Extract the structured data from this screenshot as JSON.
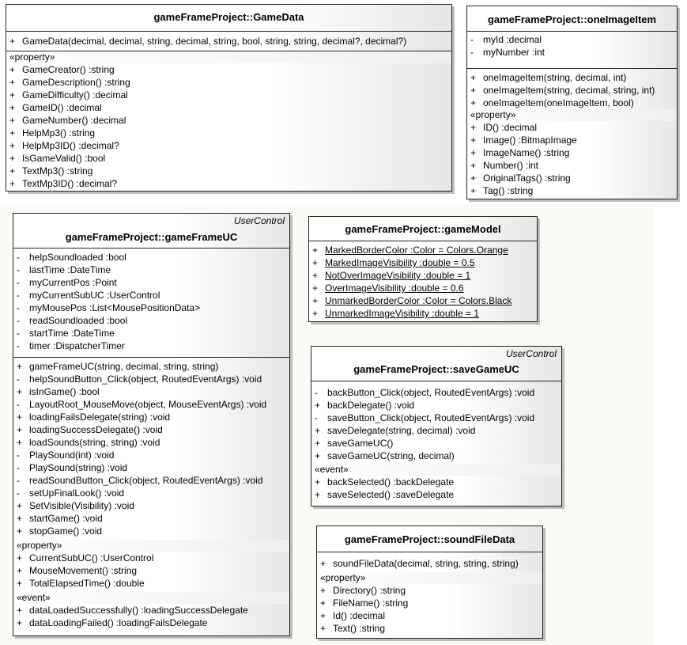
{
  "classes": {
    "gamedata": {
      "title": "gameFrameProject::GameData",
      "ctor": [
        {
          "v": "+",
          "t": "GameData(decimal, decimal, string, decimal, string, bool, string, string, decimal?, decimal?)"
        }
      ],
      "prop_label": "«property»",
      "props": [
        {
          "v": "+",
          "t": "GameCreator()  :string"
        },
        {
          "v": "+",
          "t": "GameDescription()  :string"
        },
        {
          "v": "+",
          "t": "GameDifficulty()  :decimal"
        },
        {
          "v": "+",
          "t": "GameID()  :decimal"
        },
        {
          "v": "+",
          "t": "GameNumber()  :decimal"
        },
        {
          "v": "+",
          "t": "HelpMp3()  :string"
        },
        {
          "v": "+",
          "t": "HelpMp3ID()  :decimal?"
        },
        {
          "v": "+",
          "t": "IsGameValid()  :bool"
        },
        {
          "v": "+",
          "t": "TextMp3()  :string"
        },
        {
          "v": "+",
          "t": "TextMp3ID()  :decimal?"
        }
      ]
    },
    "oneimageitem": {
      "title": "gameFrameProject::oneImageItem",
      "attrs": [
        {
          "v": "-",
          "t": "myId  :decimal"
        },
        {
          "v": "-",
          "t": "myNumber  :int"
        }
      ],
      "ops": [
        {
          "v": "+",
          "t": "oneImageItem(string, decimal, int)"
        },
        {
          "v": "+",
          "t": "oneImageItem(string, decimal, string, int)"
        },
        {
          "v": "+",
          "t": "oneImageItem(oneImageItem, bool)"
        }
      ],
      "prop_label": "«property»",
      "props": [
        {
          "v": "+",
          "t": "ID()  :decimal"
        },
        {
          "v": "+",
          "t": "Image()  :BitmapImage"
        },
        {
          "v": "+",
          "t": "ImageName()  :string"
        },
        {
          "v": "+",
          "t": "Number()  :int"
        },
        {
          "v": "+",
          "t": "OriginalTags()  :string"
        },
        {
          "v": "+",
          "t": "Tag()  :string"
        }
      ]
    },
    "gameframeuc": {
      "stereotype": "UserControl",
      "title": "gameFrameProject::gameFrameUC",
      "attrs": [
        {
          "v": "-",
          "t": "helpSoundloaded  :bool"
        },
        {
          "v": "-",
          "t": "lastTime  :DateTime"
        },
        {
          "v": "-",
          "t": "myCurrentPos  :Point"
        },
        {
          "v": "-",
          "t": "myCurrentSubUC  :UserControl"
        },
        {
          "v": "-",
          "t": "myMousePos  :List<MousePositionData>"
        },
        {
          "v": "-",
          "t": "readSoundloaded  :bool"
        },
        {
          "v": "-",
          "t": "startTime  :DateTime"
        },
        {
          "v": "-",
          "t": "timer  :DispatcherTimer"
        }
      ],
      "ops": [
        {
          "v": "+",
          "t": "gameFrameUC(string, decimal, string, string)"
        },
        {
          "v": "-",
          "t": "helpSoundButton_Click(object, RoutedEventArgs)  :void"
        },
        {
          "v": "+",
          "t": "isInGame()  :bool"
        },
        {
          "v": "-",
          "t": "LayoutRoot_MouseMove(object, MouseEventArgs)  :void"
        },
        {
          "v": "+",
          "t": "loadingFailsDelegate(string)  :void"
        },
        {
          "v": "+",
          "t": "loadingSuccessDelegate()  :void"
        },
        {
          "v": "+",
          "t": "loadSounds(string, string)  :void"
        },
        {
          "v": "-",
          "t": "PlaySound(int)  :void"
        },
        {
          "v": "-",
          "t": "PlaySound(string)  :void"
        },
        {
          "v": "-",
          "t": "readSoundButton_Click(object, RoutedEventArgs)  :void"
        },
        {
          "v": "-",
          "t": "setUpFinalLook()  :void"
        },
        {
          "v": "+",
          "t": "SetVisible(Visibility)  :void"
        },
        {
          "v": "+",
          "t": "startGame()  :void"
        },
        {
          "v": "+",
          "t": "stopGame()  :void"
        }
      ],
      "prop_label": "«property»",
      "props": [
        {
          "v": "+",
          "t": "CurrentSubUC()  :UserControl"
        },
        {
          "v": "+",
          "t": "MouseMovement()  :string"
        },
        {
          "v": "+",
          "t": "TotalElapsedTime()  :double"
        }
      ],
      "event_label": "«event»",
      "events": [
        {
          "v": "+",
          "t": "dataLoadedSuccessfully()  :loadingSuccessDelegate"
        },
        {
          "v": "+",
          "t": "dataLoadingFailed()  :loadingFailsDelegate"
        }
      ]
    },
    "gamemodel": {
      "title": "gameFrameProject::gameModel",
      "attrs": [
        {
          "v": "+",
          "t": "MarkedBorderColor  :Color = Colors.Orange"
        },
        {
          "v": "+",
          "t": "MarkedImageVisibility  :double = 0.5"
        },
        {
          "v": "+",
          "t": "NotOverImageVisibility  :double = 1"
        },
        {
          "v": "+",
          "t": "OverImageVisibility  :double = 0.6"
        },
        {
          "v": "+",
          "t": "UnmarkedBorderColor  :Color = Colors.Black"
        },
        {
          "v": "+",
          "t": "UnmarkedImageVisibility  :double = 1"
        }
      ]
    },
    "savegameuc": {
      "stereotype": "UserControl",
      "title": "gameFrameProject::saveGameUC",
      "ops": [
        {
          "v": "-",
          "t": "backButton_Click(object, RoutedEventArgs)  :void"
        },
        {
          "v": "+",
          "t": "backDelegate()  :void"
        },
        {
          "v": "-",
          "t": "saveButton_Click(object, RoutedEventArgs)  :void"
        },
        {
          "v": "+",
          "t": "saveDelegate(string, decimal)  :void"
        },
        {
          "v": "+",
          "t": "saveGameUC()"
        },
        {
          "v": "+",
          "t": "saveGameUC(string, decimal)"
        }
      ],
      "event_label": "«event»",
      "events": [
        {
          "v": "+",
          "t": "backSelected()  :backDelegate"
        },
        {
          "v": "+",
          "t": "saveSelected()  :saveDelegate"
        }
      ]
    },
    "soundfiledata": {
      "title": "gameFrameProject::soundFileData",
      "ctor": [
        {
          "v": "+",
          "t": "soundFileData(decimal, string, string, string)"
        }
      ],
      "prop_label": "«property»",
      "props": [
        {
          "v": "+",
          "t": "Directory()  :string"
        },
        {
          "v": "+",
          "t": "FileName()  :string"
        },
        {
          "v": "+",
          "t": "Id()  :decimal"
        },
        {
          "v": "+",
          "t": "Text()  :string"
        }
      ]
    }
  }
}
